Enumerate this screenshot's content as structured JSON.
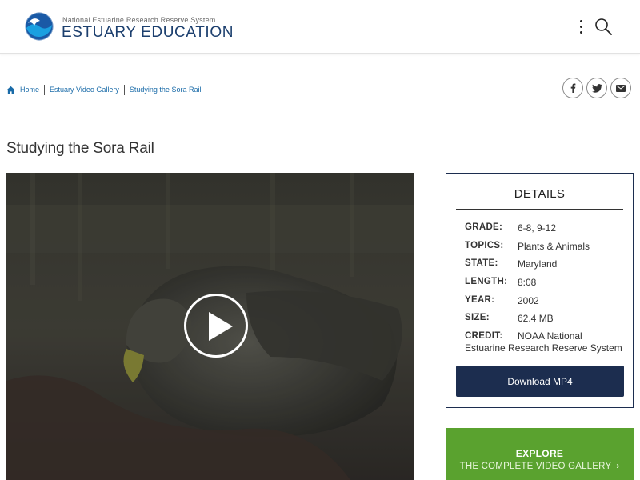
{
  "header": {
    "subtitle": "National Estuarine Research Reserve System",
    "title": "ESTUARY EDUCATION"
  },
  "breadcrumb": {
    "items": [
      "Home",
      "Estuary Video Gallery",
      "Studying the Sora Rail"
    ]
  },
  "share": {
    "icons": [
      "facebook-icon",
      "twitter-icon",
      "email-icon"
    ]
  },
  "page": {
    "title": "Studying the Sora Rail"
  },
  "details": {
    "heading": "DETAILS",
    "rows": [
      {
        "label": "GRADE:",
        "value": "6-8, 9-12"
      },
      {
        "label": "TOPICS:",
        "value": "Plants & Animals"
      },
      {
        "label": "STATE:",
        "value": "Maryland"
      },
      {
        "label": "LENGTH:",
        "value": "8:08"
      },
      {
        "label": "YEAR:",
        "value": "2002"
      },
      {
        "label": "SIZE:",
        "value": "62.4 MB"
      },
      {
        "label": "CREDIT:",
        "value": "NOAA National Estuarine Research Reserve System"
      }
    ],
    "download_label": "Download MP4"
  },
  "explore": {
    "top": "EXPLORE",
    "bottom": "THE COMPLETE VIDEO GALLERY",
    "chevron": "›"
  },
  "colors": {
    "brand_navy": "#1c2d4f",
    "link_blue": "#1a6ba8",
    "explore_green": "#5aa22f"
  }
}
